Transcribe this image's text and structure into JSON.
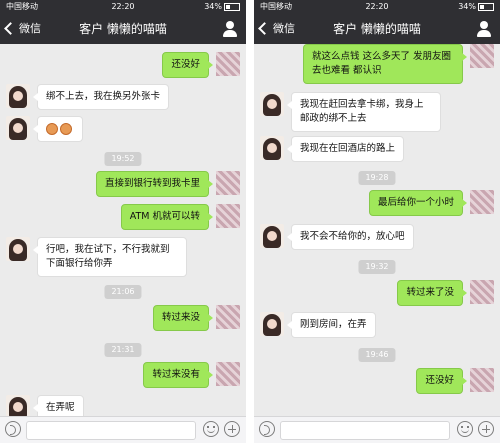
{
  "left": {
    "status": {
      "carrier": "中国移动",
      "time": "22:20",
      "battery": "34%"
    },
    "nav": {
      "back_label": "微信",
      "title": "客户 懒懒的喵喵"
    },
    "messages": [
      {
        "text": "还没好"
      },
      {
        "text": "绑不上去，我在换另外张卡"
      },
      {
        "time": "19:52"
      },
      {
        "text": "直接到银行转到我卡里"
      },
      {
        "text": "ATM 机就可以转"
      },
      {
        "text": "行吧，我在试下，不行我就到下面银行给你弄"
      },
      {
        "time": "21:06"
      },
      {
        "text": "转过来没"
      },
      {
        "time": "21:31"
      },
      {
        "text": "转过来没有"
      },
      {
        "text": "在弄呢"
      }
    ]
  },
  "right": {
    "status": {
      "carrier": "中国移动",
      "time": "22:20",
      "battery": "34%"
    },
    "nav": {
      "back_label": "微信",
      "title": "客户 懒懒的喵喵"
    },
    "messages": [
      {
        "text": "就这么点钱 这么多天了 发朋友圈去也难看 都认识"
      },
      {
        "text": "我现在赶回去拿卡绑，我身上邮政的绑不上去"
      },
      {
        "text": "我现在在回酒店的路上"
      },
      {
        "time": "19:28"
      },
      {
        "text": "最后给你一个小时"
      },
      {
        "text": "我不会不给你的，放心吧"
      },
      {
        "time": "19:32"
      },
      {
        "text": "转过来了没"
      },
      {
        "text": "刚到房间，在弄"
      },
      {
        "time": "19:46"
      },
      {
        "text": "还没好"
      }
    ]
  }
}
